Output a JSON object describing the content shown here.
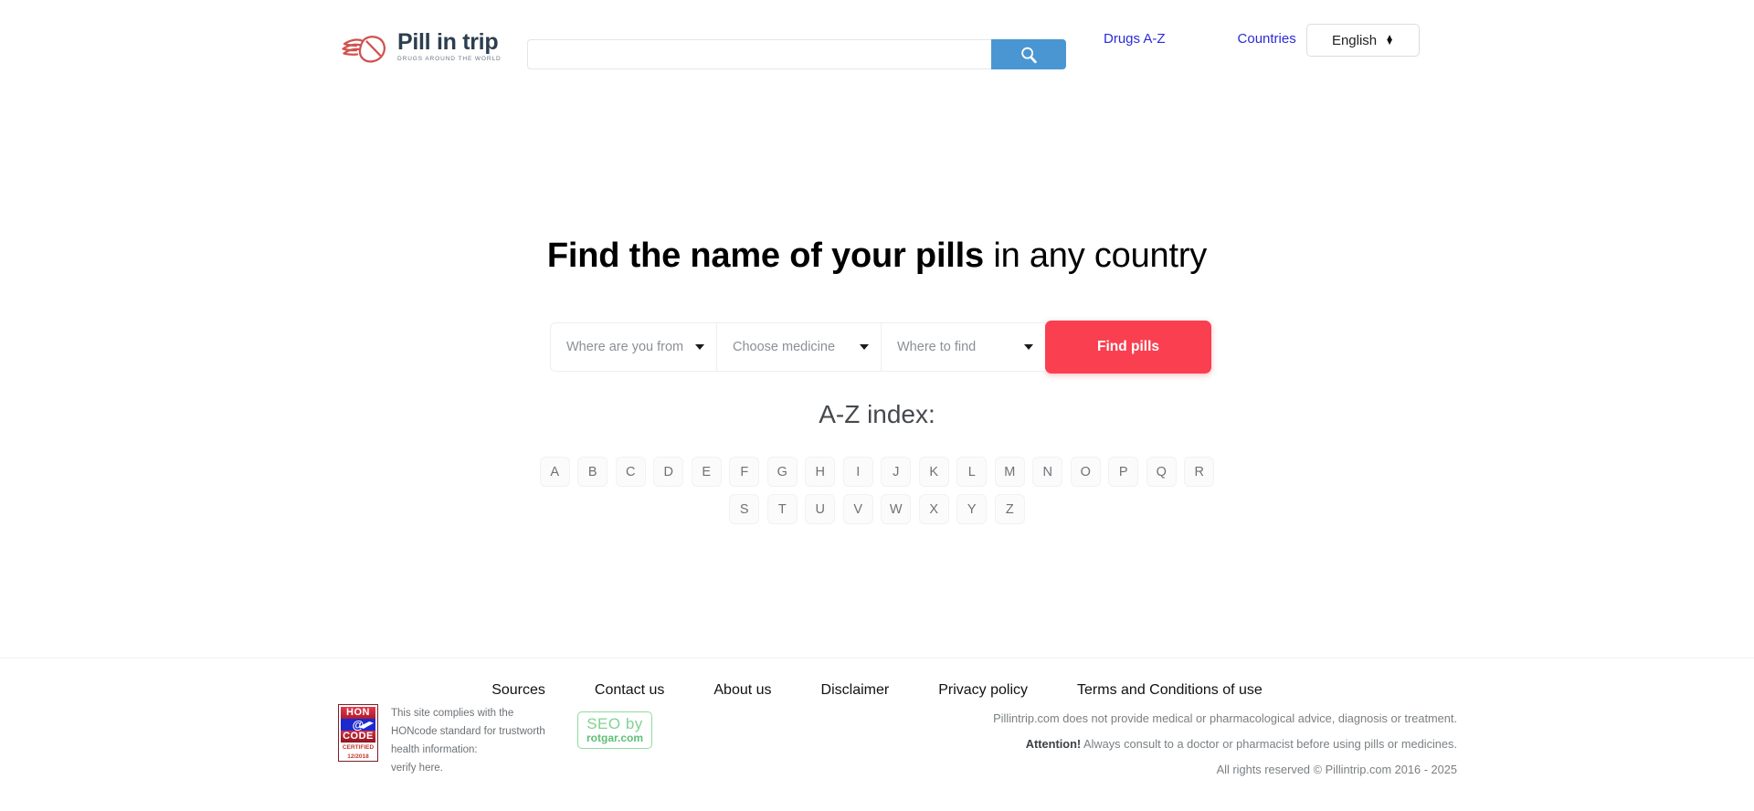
{
  "header": {
    "logo": {
      "icon": "winged-pill-icon",
      "title": "Pill in trip",
      "tagline": "DRUGS AROUND THE WORLD",
      "accent_color": "#d9534f",
      "text_color": "#2c3e50"
    },
    "search": {
      "value": "",
      "placeholder": "",
      "button_icon": "search-icon",
      "button_color": "#4a96d2"
    },
    "nav": [
      {
        "label": "Drugs A-Z"
      },
      {
        "label": "Countries"
      }
    ],
    "language": {
      "selected": "English",
      "icon": "updown-arrows-icon"
    }
  },
  "main": {
    "headline_bold": "Find the name of your pills",
    "headline_rest": " in any country",
    "finder": {
      "fields": [
        {
          "label": "Where are you from",
          "icon": "chevron-down-icon"
        },
        {
          "label": "Choose medicine",
          "icon": "chevron-down-icon"
        },
        {
          "label": "Where to find",
          "icon": "chevron-down-icon"
        }
      ],
      "submit_label": "Find pills",
      "submit_color": "#fa3f50"
    },
    "az_title": "A-Z index:",
    "az_rows": [
      [
        "A",
        "B",
        "C",
        "D",
        "E",
        "F",
        "G",
        "H",
        "I",
        "J",
        "K",
        "L",
        "M",
        "N",
        "O",
        "P",
        "Q",
        "R"
      ],
      [
        "S",
        "T",
        "U",
        "V",
        "W",
        "X",
        "Y",
        "Z"
      ]
    ]
  },
  "footer": {
    "nav": [
      {
        "label": "Sources"
      },
      {
        "label": "Contact us"
      },
      {
        "label": "About us"
      },
      {
        "label": "Disclaimer"
      },
      {
        "label": "Privacy policy"
      },
      {
        "label": "Terms and Conditions of use"
      }
    ],
    "hon_badge": {
      "top": "HON",
      "mid": "@",
      "bot": "CODE",
      "certified_label": "CERTIFIED",
      "certified_date": "12/2018"
    },
    "hon_text_lines": [
      "This site complies with the",
      "HONcode standard for trustworth",
      "health information:",
      "verify here."
    ],
    "seo_badge": {
      "top": "SEO by",
      "bottom": "rotgar.com",
      "color": "#7fd391"
    },
    "disclaimer_line1": "Pillintrip.com does not provide medical or pharmacological advice, diagnosis or treatment.",
    "attention_label": "Attention!",
    "disclaimer_line2": " Always consult to a doctor or pharmacist before using pills or medicines.",
    "copyright": "All rights reserved © Pillintrip.com 2016 - 2025"
  }
}
